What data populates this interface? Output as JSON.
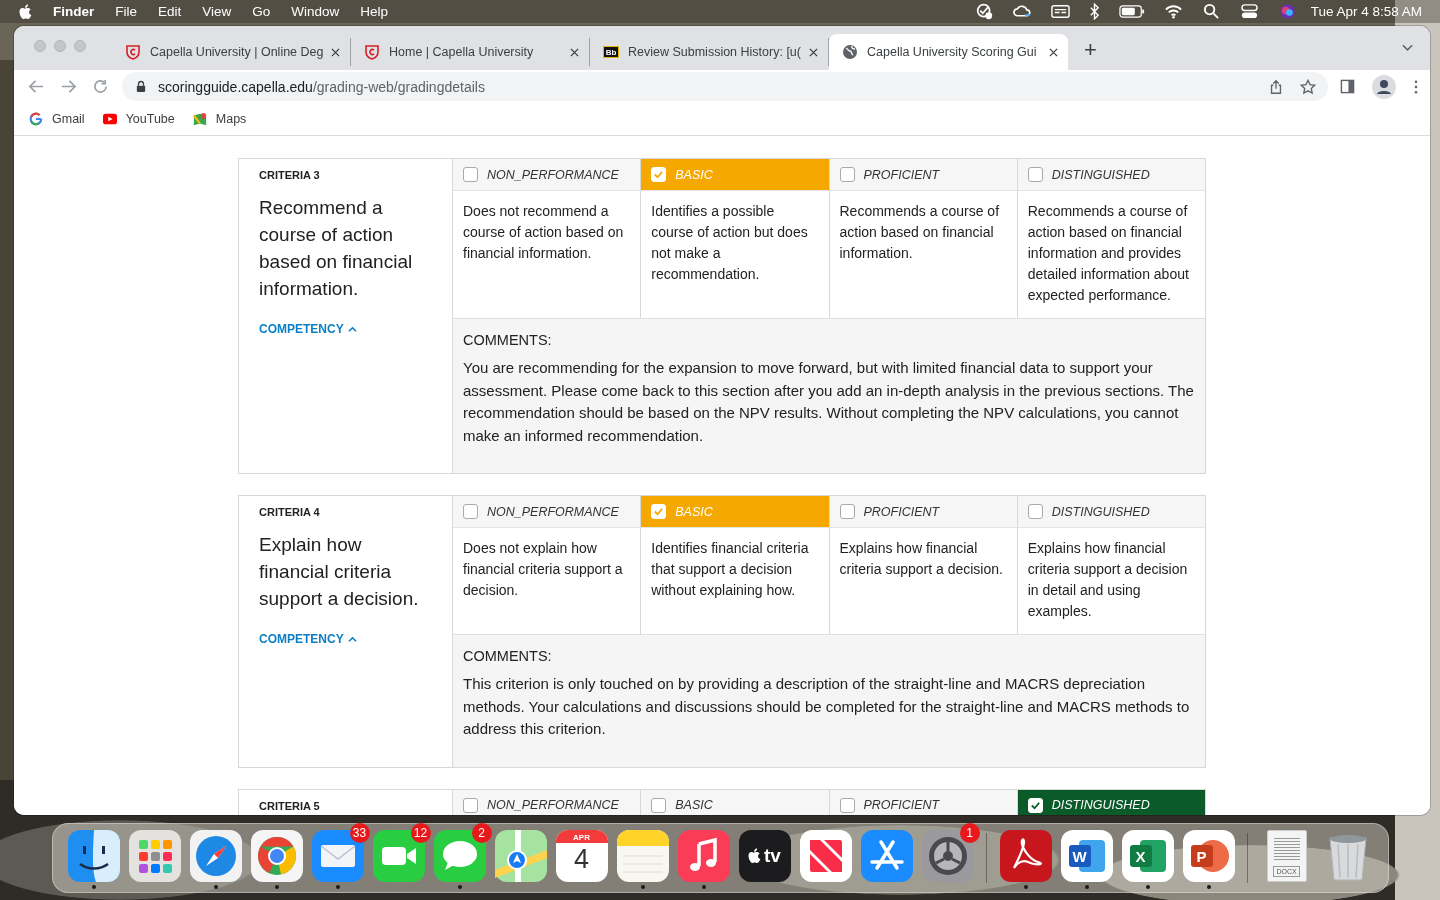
{
  "menu_bar": {
    "app": "Finder",
    "menus": [
      "File",
      "Edit",
      "View",
      "Go",
      "Window",
      "Help"
    ],
    "clock": "Tue Apr 4  8:58 AM"
  },
  "browser": {
    "tabs": [
      {
        "title": "Capella University | Online Deg",
        "kind": "shield",
        "selected": false
      },
      {
        "title": "Home | Capella University",
        "kind": "shield",
        "selected": false
      },
      {
        "title": "Review Submission History: [u(",
        "kind": "blackboard",
        "icon_text": "Bb",
        "selected": false
      },
      {
        "title": "Capella University Scoring Gui",
        "kind": "globe",
        "selected": true
      }
    ],
    "new_tab": "+",
    "url": {
      "host": "scoringguide.capella.edu",
      "path": "/grading-web/gradingdetails"
    },
    "bookmarks": [
      {
        "label": "Gmail",
        "kind": "google"
      },
      {
        "label": "YouTube",
        "kind": "youtube"
      },
      {
        "label": "Maps",
        "kind": "maps"
      }
    ]
  },
  "criteria": [
    {
      "label": "CRITERIA 3",
      "title": "Recommend a course of action based on financial information.",
      "competency": "COMPETENCY",
      "levels": [
        {
          "name": "NON_PERFORMANCE",
          "checked": false,
          "description": "Does not recommend a course of action based on financial information."
        },
        {
          "name": "BASIC",
          "checked": true,
          "description": "Identifies a possible course of action but does not make a recommendation."
        },
        {
          "name": "PROFICIENT",
          "checked": false,
          "description": "Recommends a course of action based on financial information."
        },
        {
          "name": "DISTINGUISHED",
          "checked": false,
          "description": "Recommends a course of action based on financial information and provides detailed information about expected performance."
        }
      ],
      "comments_label": "COMMENTS:",
      "comments": "You are recommending for the expansion to move forward, but with limited financial data to support your assessment. Please come back to this section after you add an in-depth analysis in the previous sections. The recommendation should be based on the NPV results. Without completing the NPV calculations, you cannot make an informed recommendation."
    },
    {
      "label": "CRITERIA 4",
      "title": "Explain how financial criteria support a decision.",
      "competency": "COMPETENCY",
      "levels": [
        {
          "name": "NON_PERFORMANCE",
          "checked": false,
          "description": "Does not explain how financial criteria support a decision."
        },
        {
          "name": "BASIC",
          "checked": true,
          "description": "Identifies financial criteria that support a decision without explaining how."
        },
        {
          "name": "PROFICIENT",
          "checked": false,
          "description": "Explains how financial criteria support a decision."
        },
        {
          "name": "DISTINGUISHED",
          "checked": false,
          "description": "Explains how financial criteria support a decision in detail and using examples."
        }
      ],
      "comments_label": "COMMENTS:",
      "comments": "This criterion is only touched on by providing a description of the straight-line and MACRS depreciation methods. Your calculations and discussions should be completed for the straight-line and MACRS methods to address this criterion."
    },
    {
      "label": "CRITERIA 5",
      "levels": [
        {
          "name": "NON_PERFORMANCE",
          "checked": false
        },
        {
          "name": "BASIC",
          "checked": false
        },
        {
          "name": "PROFICIENT",
          "checked": false
        },
        {
          "name": "DISTINGUISHED",
          "checked": true
        }
      ]
    }
  ],
  "dock": {
    "sections": [
      {
        "items": [
          {
            "kind": "finder",
            "running": true
          },
          {
            "kind": "launchpad"
          },
          {
            "kind": "safari",
            "running": true
          },
          {
            "kind": "chrome",
            "running": true
          },
          {
            "kind": "mail",
            "running": true,
            "badge": "33"
          },
          {
            "kind": "facetime",
            "badge": "12"
          },
          {
            "kind": "messages",
            "running": true,
            "badge": "2"
          },
          {
            "kind": "maps"
          },
          {
            "kind": "calendar",
            "text": "APR",
            "text2": "4"
          },
          {
            "kind": "notes",
            "running": true
          },
          {
            "kind": "music",
            "running": true
          },
          {
            "kind": "tv",
            "text": "tv"
          },
          {
            "kind": "news"
          },
          {
            "kind": "appstore"
          },
          {
            "kind": "settings",
            "badge": "1"
          }
        ]
      },
      {
        "items": [
          {
            "kind": "acrobat",
            "running": true
          },
          {
            "kind": "word",
            "running": true,
            "text": "W"
          },
          {
            "kind": "excel",
            "running": true,
            "text": "X"
          },
          {
            "kind": "powerpoint",
            "running": true,
            "text": "P"
          }
        ]
      },
      {
        "items": [
          {
            "kind": "document",
            "text": "DOCX"
          },
          {
            "kind": "trash"
          }
        ]
      }
    ]
  }
}
